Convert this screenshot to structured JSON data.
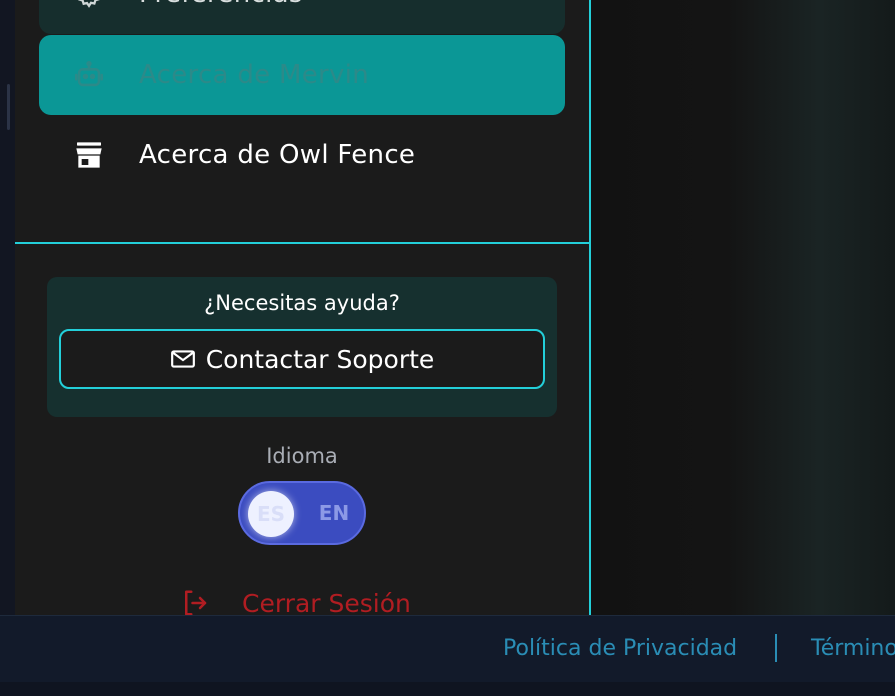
{
  "sidebar": {
    "items": [
      {
        "label": "Preferencias",
        "icon": "gear-icon"
      },
      {
        "label": "Acerca de Mervin",
        "icon": "robot-icon",
        "active": true
      },
      {
        "label": "Acerca de Owl Fence",
        "icon": "store-icon"
      }
    ]
  },
  "help": {
    "title": "¿Necesitas ayuda?",
    "contact_label": "Contactar Soporte",
    "contact_icon": "mail-icon"
  },
  "language": {
    "label": "Idioma",
    "options": [
      "ES",
      "EN"
    ],
    "selected": "ES"
  },
  "logout": {
    "label": "Cerrar Sesión",
    "icon": "logout-icon"
  },
  "footer": {
    "privacy": "Política de Privacidad",
    "terms": "Términos"
  },
  "colors": {
    "accent": "#23cfd9",
    "active_item": "#0b9796",
    "toggle": "#3b4cc0",
    "logout": "#b11d22",
    "footer_link": "#2a8db5"
  }
}
